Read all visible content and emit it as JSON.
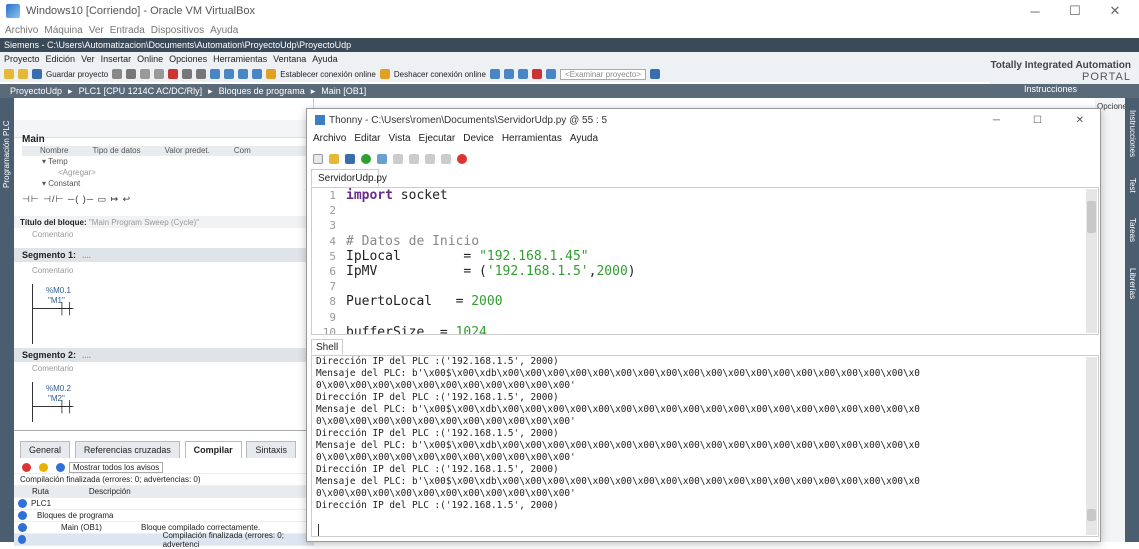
{
  "vbox": {
    "title": "Windows10 [Corriendo] - Oracle VM VirtualBox",
    "menu": [
      "Archivo",
      "Máquina",
      "Ver",
      "Entrada",
      "Dispositivos",
      "Ayuda"
    ]
  },
  "tia": {
    "title": "Siemens - C:\\Users\\Automatizacion\\Documents\\Automation\\ProyectoUdp\\ProyectoUdp",
    "menu": [
      "Proyecto",
      "Edición",
      "Ver",
      "Insertar",
      "Online",
      "Opciones",
      "Herramientas",
      "Ventana",
      "Ayuda"
    ],
    "toolbar": {
      "save": "Guardar proyecto",
      "connect": "Establecer conexión online",
      "disconnect": "Deshacer conexión online",
      "search": "<Examinar proyecto>"
    },
    "brand": "Totally Integrated Automation",
    "portal": "PORTAL",
    "breadcrumb": [
      "ProyectoUdp",
      "PLC1 [CPU 1214C AC/DC/Rly]",
      "Bloques de programa",
      "Main [OB1]"
    ],
    "side_label": "Programación PLC",
    "right_top": "Instrucciones",
    "right_opts": "Opciones",
    "right_tabs": [
      "Instrucciones",
      "Test",
      "Tareas",
      "Librerías"
    ],
    "editor": {
      "block": "Main",
      "iface_cols": [
        "Nombre",
        "Tipo de datos",
        "Valor predet.",
        "Com"
      ],
      "iface_rows": [
        "Temp",
        "<Agregar>",
        "Constant"
      ],
      "block_title_label": "Título del bloque:",
      "block_title": "\"Main Program Sweep (Cycle)\"",
      "comment": "Comentario",
      "segments": [
        {
          "label": "Segmento 1:",
          "dots": "....",
          "addr": "%M0.1",
          "name": "\"M1\""
        },
        {
          "label": "Segmento 2:",
          "dots": "....",
          "addr": "%M0.2",
          "name": "\"M2\""
        }
      ]
    },
    "inspector": {
      "tabs": [
        "General",
        "Referencias cruzadas",
        "Compilar",
        "Sintaxis"
      ],
      "filter": "Mostrar todos los avisos",
      "summary": "Compilación finalizada (errores: 0; advertencias: 0)",
      "cols": [
        "Ruta",
        "Descripción"
      ],
      "rows": [
        {
          "path": "PLC1",
          "desc": ""
        },
        {
          "path": "Bloques de programa",
          "desc": ""
        },
        {
          "path": "Main (OB1)",
          "desc": "Bloque compilado correctamente."
        },
        {
          "path": "",
          "desc": "Compilación finalizada (errores: 0; advertenci"
        }
      ]
    }
  },
  "thonny": {
    "title": "Thonny - C:\\Users\\romen\\Documents\\ServidorUdp.py @ 55 : 5",
    "menu": [
      "Archivo",
      "Editar",
      "Vista",
      "Ejecutar",
      "Device",
      "Herramientas",
      "Ayuda"
    ],
    "file_tab": "ServidorUdp.py",
    "shell_tab": "Shell",
    "code": [
      {
        "n": "1",
        "parts": [
          {
            "t": "import",
            "c": "kw"
          },
          {
            "t": " socket",
            "c": ""
          }
        ]
      },
      {
        "n": "2",
        "parts": []
      },
      {
        "n": "3",
        "parts": []
      },
      {
        "n": "4",
        "parts": [
          {
            "t": "# Datos de Inicio",
            "c": "cm"
          }
        ]
      },
      {
        "n": "5",
        "parts": [
          {
            "t": "IpLocal        = ",
            "c": ""
          },
          {
            "t": "\"192.168.1.45\"",
            "c": "str"
          }
        ]
      },
      {
        "n": "6",
        "parts": [
          {
            "t": "IpMV           = (",
            "c": ""
          },
          {
            "t": "'192.168.1.5'",
            "c": "str"
          },
          {
            "t": ",",
            "c": ""
          },
          {
            "t": "2000",
            "c": "num"
          },
          {
            "t": ")",
            "c": ""
          }
        ]
      },
      {
        "n": "7",
        "parts": []
      },
      {
        "n": "8",
        "parts": [
          {
            "t": "PuertoLocal   = ",
            "c": ""
          },
          {
            "t": "2000",
            "c": "num"
          }
        ]
      },
      {
        "n": "9",
        "parts": []
      },
      {
        "n": "10",
        "parts": [
          {
            "t": "bufferSize  = ",
            "c": ""
          },
          {
            "t": "1024",
            "c": "num"
          }
        ]
      }
    ],
    "shell": [
      "Dirección IP del PLC :('192.168.1.5', 2000)",
      "Mensaje del PLC: b'\\x00$\\x00\\xdb\\x00\\x00\\x00\\x00\\x00\\x00\\x00\\x00\\x00\\x00\\x00\\x00\\x00\\x00\\x00\\x00\\x00\\x00\\x0",
      "0\\x00\\x00\\x00\\x00\\x00\\x00\\x00\\x00\\x00\\x00\\x00'",
      "Dirección IP del PLC :('192.168.1.5', 2000)",
      "Mensaje del PLC: b'\\x00$\\x00\\xdb\\x00\\x00\\x00\\x00\\x00\\x00\\x00\\x00\\x00\\x00\\x00\\x00\\x00\\x00\\x00\\x00\\x00\\x00\\x0",
      "0\\x00\\x00\\x00\\x00\\x00\\x00\\x00\\x00\\x00\\x00\\x00'",
      "Dirección IP del PLC :('192.168.1.5', 2000)",
      "Mensaje del PLC: b'\\x00$\\x00\\xdb\\x00\\x00\\x00\\x00\\x00\\x00\\x00\\x00\\x00\\x00\\x00\\x00\\x00\\x00\\x00\\x00\\x00\\x00\\x0",
      "0\\x00\\x00\\x00\\x00\\x00\\x00\\x00\\x00\\x00\\x00\\x00'",
      "Dirección IP del PLC :('192.168.1.5', 2000)",
      "Mensaje del PLC: b'\\x00$\\x00\\xdb\\x00\\x00\\x00\\x00\\x00\\x00\\x00\\x00\\x00\\x00\\x00\\x00\\x00\\x00\\x00\\x00\\x00\\x00\\x0",
      "0\\x00\\x00\\x00\\x00\\x00\\x00\\x00\\x00\\x00\\x00\\x00'",
      "Dirección IP del PLC :('192.168.1.5', 2000)"
    ]
  },
  "colors": {
    "tia_dark": "#3b4a58",
    "keyword": "#6b2b8c",
    "string": "#2f9e2f",
    "accent": "#2f6fd8"
  }
}
